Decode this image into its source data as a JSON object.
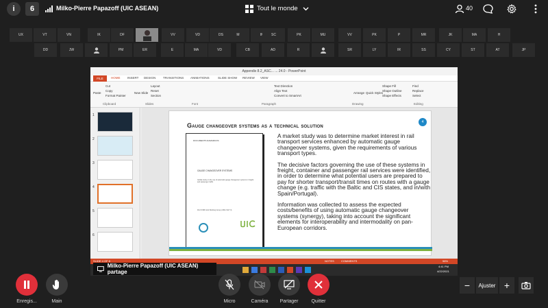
{
  "topbar": {
    "info_label": "i",
    "lock_label": "6",
    "meeting_title": "Milko-Pierre Papazoff (UIC ASEAN)",
    "view_label": "Tout le monde",
    "participant_count": "40"
  },
  "participants": {
    "row1": [
      "UX",
      "VT",
      "VN",
      "IK",
      "DF",
      "",
      "VV",
      "VD",
      "DS",
      "M",
      "IM",
      "SC",
      "PK",
      "MU",
      "VV",
      "PK",
      "P",
      "MR",
      "JK",
      "MA",
      "H"
    ],
    "row2": [
      "DD",
      "JW",
      "",
      "PM",
      "ER",
      "E",
      "MA",
      "VD",
      "CB",
      "AD",
      "R",
      "",
      "SR",
      "LY",
      "IR",
      "SS",
      "CY",
      "ST",
      "AT",
      "JP"
    ]
  },
  "powerpoint": {
    "window_title": "Appendix 8.2_ASC... ... 24.0 - PowerPoint",
    "tabs": [
      "FILE",
      "HOME",
      "INSERT",
      "DESIGN",
      "TRANSITIONS",
      "ANIMATIONS",
      "SLIDE SHOW",
      "REVIEW",
      "VIEW"
    ],
    "ribbon_groups": [
      "Clipboard",
      "Slides",
      "Font",
      "Paragraph",
      "Drawing",
      "Editing"
    ],
    "ribbon_items": {
      "paste": "Paste",
      "cut": "Cut",
      "copy": "Copy",
      "format_painter": "Format Painter",
      "new_slide": "New Slide",
      "layout": "Layout",
      "reset": "Reset",
      "section": "Section",
      "text_direction": "Text Direction",
      "align_text": "Align Text",
      "convert_smartart": "Convert to SmartArt",
      "arrange": "Arrange",
      "quick_styles": "Quick Styles",
      "shape_fill": "Shape Fill",
      "shape_outline": "Shape Outline",
      "shape_effects": "Shape Effects",
      "find": "Find",
      "replace": "Replace",
      "select": "Select"
    },
    "slide_numbers": [
      "1",
      "2",
      "3",
      "4",
      "5",
      "6"
    ],
    "selected_slide": "4",
    "slide": {
      "title": "Gauge changeover systems as a technical solution",
      "number": "4",
      "doc_header": "DOCUMENTS DAMARCOS",
      "doc_heading": "GAUGE CHANGEOVER SYSTEMS",
      "doc_sub": "Global study on the use of automatic gauge changeover systems in freight and passenger traffic",
      "doc_foot": "DG FCSB Joint Working Group (JWG SGT II)",
      "paragraphs": [
        "A market study was to determine market interest in rail transport services enhanced by automatic gauge changeover systems, given the requirements of various transport types.",
        "The decisive factors governing the use of these systems in freight, container and passenger rail services were identified, in order to determine what potential users are prepared to pay for shorter transport/transit times on routes with a gauge change (e.g. traffic with the Baltic and CIS states, and in/with Spain/Portugal).",
        "Information was collected to assess the expected costs/benefits of using automatic gauge changeover systems (synergy), taking into account the significant elements for interoperability and intermodality on pan-European corridors."
      ]
    },
    "status": {
      "slide_of": "SLIDE 4 OF 8",
      "notes": "NOTES",
      "comments": "COMMENTS",
      "zoom": "58%"
    },
    "taskbar": {
      "time": "4:41 PM",
      "date": "4/22/2021"
    }
  },
  "share_banner": {
    "text": "Milko-Pierre Papazoff (UIC ASEAN) partage"
  },
  "controls": {
    "record_label": "Enregis...",
    "hand_label": "Main",
    "mic_label": "Micro",
    "camera_label": "Caméra",
    "share_label": "Partager",
    "leave_label": "Quitter",
    "zoom_fit_label": "Ajuster",
    "zoom_minus": "−",
    "zoom_plus": "+"
  },
  "colors": {
    "record": "#e0303a",
    "leave": "#e0303a",
    "ppt_accent": "#d24726"
  }
}
